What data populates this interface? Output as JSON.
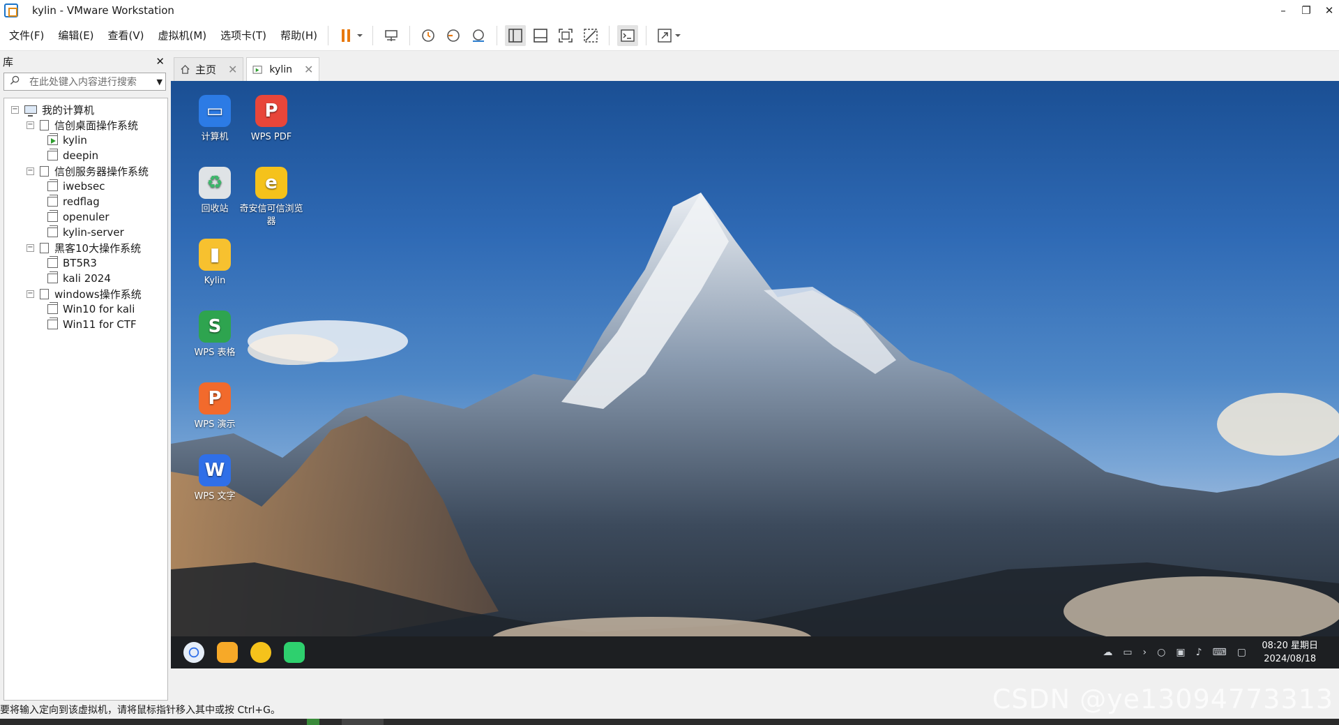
{
  "window": {
    "title": "kylin - VMware Workstation",
    "minimize": "–",
    "restore": "❐",
    "close": "✕"
  },
  "menu": [
    {
      "label": "文件(F)"
    },
    {
      "label": "编辑(E)"
    },
    {
      "label": "查看(V)"
    },
    {
      "label": "虚拟机(M)"
    },
    {
      "label": "选项卡(T)"
    },
    {
      "label": "帮助(H)"
    }
  ],
  "library": {
    "title": "库",
    "close": "✕",
    "search_placeholder": "在此处键入内容进行搜索",
    "tree": [
      {
        "label": "我的计算机",
        "level": 0,
        "kind": "computer",
        "expander": "⊟"
      },
      {
        "label": "信创桌面操作系统",
        "level": 1,
        "kind": "folder",
        "expander": "⊟"
      },
      {
        "label": "kylin",
        "level": 2,
        "kind": "vm-running"
      },
      {
        "label": "deepin",
        "level": 2,
        "kind": "vm"
      },
      {
        "label": "信创服务器操作系统",
        "level": 1,
        "kind": "folder",
        "expander": "⊟"
      },
      {
        "label": "iwebsec",
        "level": 2,
        "kind": "vm"
      },
      {
        "label": "redflag",
        "level": 2,
        "kind": "vm"
      },
      {
        "label": "openuler",
        "level": 2,
        "kind": "vm"
      },
      {
        "label": "kylin-server",
        "level": 2,
        "kind": "vm"
      },
      {
        "label": "黑客10大操作系统",
        "level": 1,
        "kind": "folder",
        "expander": "⊟"
      },
      {
        "label": "BT5R3",
        "level": 2,
        "kind": "vm"
      },
      {
        "label": "kali 2024",
        "level": 2,
        "kind": "vm"
      },
      {
        "label": "windows操作系统",
        "level": 1,
        "kind": "folder",
        "expander": "⊟"
      },
      {
        "label": "Win10 for kali",
        "level": 2,
        "kind": "vm"
      },
      {
        "label": "Win11 for CTF",
        "level": 2,
        "kind": "vm"
      }
    ]
  },
  "tabs": [
    {
      "label": "主页",
      "close": "✕"
    },
    {
      "label": "kylin",
      "close": "✕"
    }
  ],
  "desktop": {
    "icons": [
      {
        "label": "计算机",
        "icon": "computer-icon",
        "color": "#2c7be5"
      },
      {
        "label": "WPS PDF",
        "icon": "wps-pdf-icon",
        "color": "#e8463a"
      },
      {
        "label": "回收站",
        "icon": "recycle-bin-icon",
        "color": "#dfe3e6"
      },
      {
        "label": "奇安信可信浏览器",
        "icon": "browser-icon",
        "color": "#f5c21b"
      },
      {
        "label": "Kylin",
        "icon": "folder-icon",
        "color": "#f7c12f"
      },
      {
        "label": "WPS 表格",
        "icon": "wps-sheet-icon",
        "color": "#2ea44f"
      },
      {
        "label": "WPS 演示",
        "icon": "wps-slides-icon",
        "color": "#f26a2c"
      },
      {
        "label": "WPS 文字",
        "icon": "wps-writer-icon",
        "color": "#2f6fe8"
      }
    ],
    "clock_time": "08:20 星期日",
    "clock_date": "2024/08/18"
  },
  "status": {
    "text": "要将输入定向到该虚拟机，请将鼠标指针移入其中或按 Ctrl+G。"
  },
  "watermark": "CSDN @ye13094773313"
}
